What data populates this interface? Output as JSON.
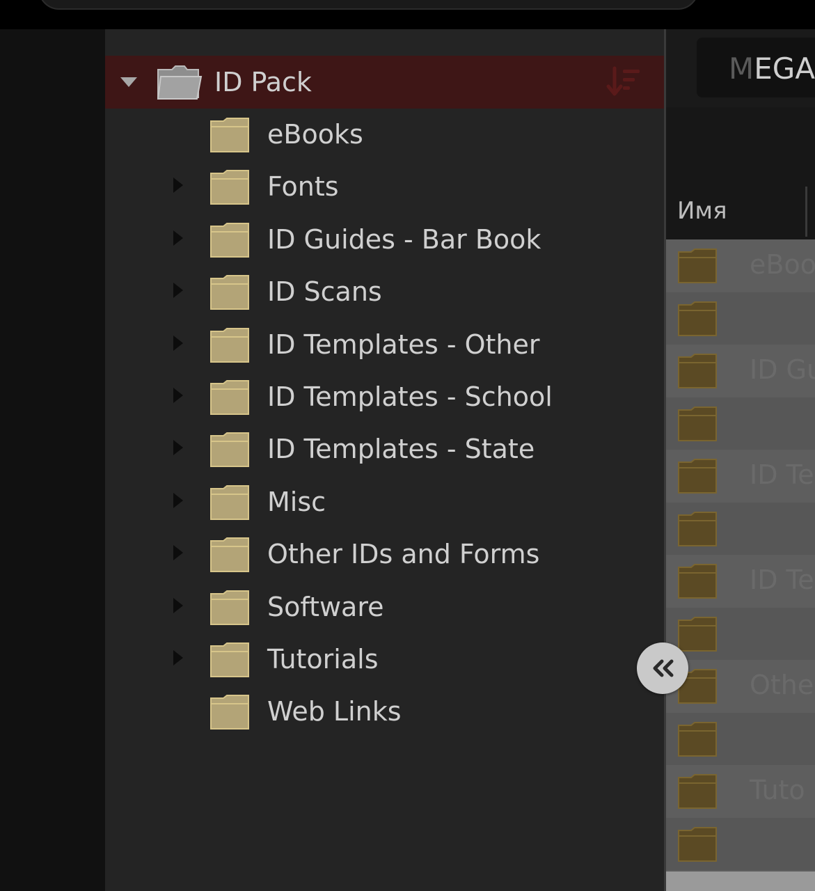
{
  "tree": {
    "root_label": "ID Pack",
    "items": [
      {
        "label": "eBooks",
        "expandable": false
      },
      {
        "label": "Fonts",
        "expandable": true
      },
      {
        "label": "ID Guides - Bar Book",
        "expandable": true
      },
      {
        "label": "ID Scans",
        "expandable": true
      },
      {
        "label": "ID Templates - Other",
        "expandable": true
      },
      {
        "label": "ID Templates - School",
        "expandable": true
      },
      {
        "label": "ID Templates - State",
        "expandable": true
      },
      {
        "label": "Misc",
        "expandable": true
      },
      {
        "label": "Other IDs and Forms",
        "expandable": true
      },
      {
        "label": "Software",
        "expandable": true
      },
      {
        "label": "Tutorials",
        "expandable": true
      },
      {
        "label": "Web Links",
        "expandable": false
      }
    ]
  },
  "right": {
    "search_dim": "M",
    "search_text": "EGA",
    "column_name": "Имя",
    "rows": [
      "eBoo",
      "",
      "ID Gu",
      "",
      "ID Te",
      "",
      "ID Te",
      "",
      "Othe",
      "",
      "Tuto",
      ""
    ]
  },
  "colors": {
    "root_highlight": "#3e1616",
    "folder_fill": "#b3a477",
    "folder_stroke": "#d7c58a"
  },
  "icons": {
    "root": "open-folder-icon",
    "sort": "sort-icon",
    "folder": "folder-icon",
    "collapse": "double-chevron-left-icon"
  }
}
